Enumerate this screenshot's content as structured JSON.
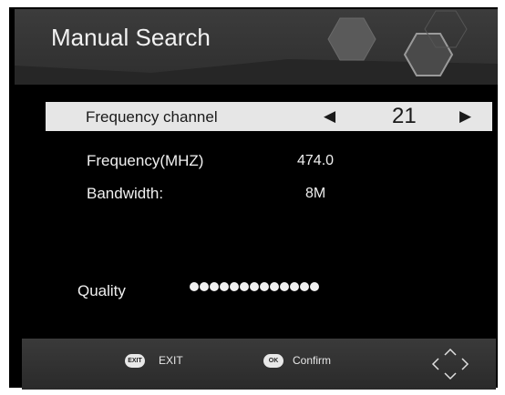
{
  "header": {
    "title": "Manual Search"
  },
  "selected_row": {
    "label": "Frequency channel",
    "value": "21"
  },
  "info": [
    {
      "label": "Frequency(MHZ)",
      "value": "474.0"
    },
    {
      "label": "Bandwidth:",
      "value": "8M"
    }
  ],
  "quality": {
    "label": "Quality",
    "dot_count": 13
  },
  "footer": {
    "exit_badge": "EXIT",
    "exit_label": "EXIT",
    "confirm_badge": "OK",
    "confirm_label": "Confirm"
  },
  "icons": {
    "left_arrow": "left-arrow-icon",
    "right_arrow": "right-arrow-icon",
    "nav": "direction-pad-icon"
  }
}
